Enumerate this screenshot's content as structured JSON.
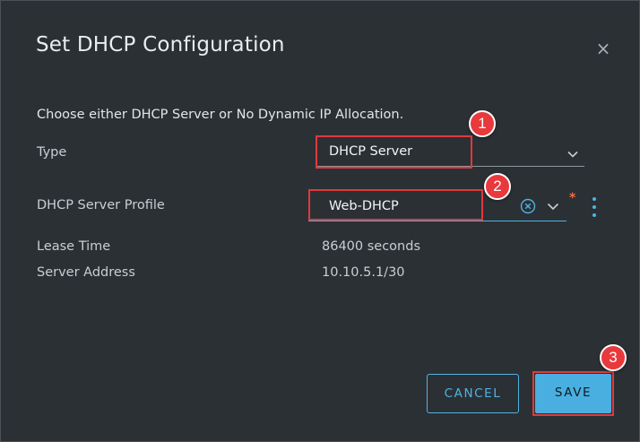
{
  "dialog": {
    "title": "Set DHCP Configuration",
    "close_glyph": "×",
    "instruction": "Choose either DHCP Server or No Dynamic IP Allocation."
  },
  "form": {
    "type": {
      "label": "Type",
      "value": "DHCP Server"
    },
    "profile": {
      "label": "DHCP Server Profile",
      "value": "Web-DHCP",
      "required_mark": "*"
    },
    "lease_time": {
      "label": "Lease Time",
      "value": "86400 seconds"
    },
    "server_address": {
      "label": "Server Address",
      "value": "10.10.5.1/30"
    }
  },
  "buttons": {
    "cancel": "CANCEL",
    "save": "SAVE"
  },
  "annotations": {
    "step1": "1",
    "step2": "2",
    "step3": "3"
  },
  "icons": {
    "close": "close-icon",
    "type_dropdown": "chevron-down-icon",
    "profile_clear": "clear-circle-icon",
    "profile_dropdown": "chevron-down-icon",
    "more_actions": "kebab-vertical-icon"
  },
  "colors": {
    "dialog_bg": "#2b3035",
    "accent": "#49afe0",
    "annotation": "#e0393b",
    "required": "#f26d3d"
  }
}
